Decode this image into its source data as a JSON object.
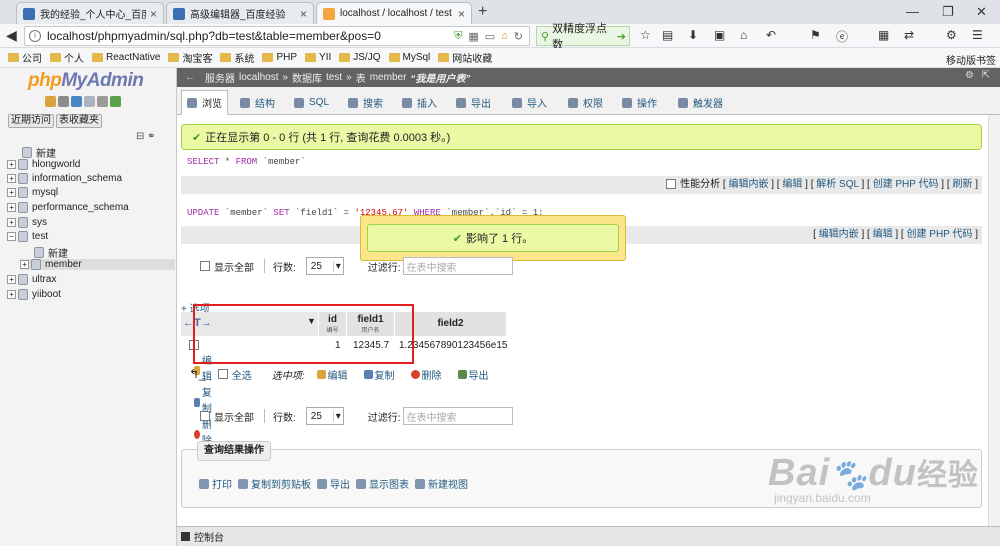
{
  "browser": {
    "tabs": [
      {
        "title": "我的经验_个人中心_百度经",
        "active": false
      },
      {
        "title": "高级编辑器_百度经验",
        "active": false
      },
      {
        "title": "localhost / localhost / test",
        "active": true
      }
    ],
    "new_tab_label": "+",
    "url": "localhost/phpmyadmin/sql.php?db=test&table=member&pos=0",
    "search_placeholder": "双精度浮点数",
    "bookmarks": [
      "公司",
      "个人",
      "ReactNative",
      "淘宝客",
      "系统",
      "PHP",
      "YII",
      "JS/JQ",
      "MySql",
      "网站收藏"
    ],
    "mobile_bookmarks": "移动版书签"
  },
  "sidebar": {
    "logo_php": "php",
    "logo_myadmin": "MyAdmin",
    "recent_label": "近期访问",
    "favorites_label": "表收藏夹",
    "new_label": "新建",
    "databases": [
      {
        "name": "hlongworld",
        "expanded": false
      },
      {
        "name": "information_schema",
        "expanded": false
      },
      {
        "name": "mysql",
        "expanded": false
      },
      {
        "name": "performance_schema",
        "expanded": false
      },
      {
        "name": "sys",
        "expanded": false
      },
      {
        "name": "test",
        "expanded": true
      }
    ],
    "test_children": {
      "new_label": "新建",
      "table": "member"
    },
    "more_databases": [
      "ultrax",
      "yiiboot"
    ]
  },
  "breadcrumb": {
    "server_label": "服务器",
    "server": "localhost",
    "db_label": "数据库",
    "db": "test",
    "table_label": "表",
    "table": "member",
    "table_comment": "“我是用户表”"
  },
  "tabs": [
    "浏览",
    "结构",
    "SQL",
    "搜索",
    "插入",
    "导出",
    "导入",
    "权限",
    "操作",
    "触发器"
  ],
  "messages": {
    "success": "正在显示第 0 - 0 行 (共 1 行, 查询花费 0.0003 秒。)",
    "affected": "影响了 1 行。"
  },
  "sql1": {
    "kw1": "SELECT",
    "rest1": " * ",
    "kw2": "FROM",
    "rest2": " `member`"
  },
  "sql1_options": {
    "profiling": "性能分析",
    "inline_edit": "编辑内嵌",
    "edit": "编辑",
    "explain": "解析 SQL",
    "create_php": "创建 PHP 代码",
    "refresh": "刷新"
  },
  "sql2": {
    "kw1": "UPDATE",
    "rest1": " `member` ",
    "kw2": "SET",
    "rest2": " `field1` = ",
    "val": "'12345.67'",
    "kw3": "WHERE",
    "rest3": " `member`.`id` = 1;"
  },
  "sql2_options": {
    "inline_edit": "编辑内嵌",
    "edit": "编辑",
    "create_php": "创建 PHP 代码"
  },
  "nav": {
    "show_all": "显示全部",
    "rows_label": "行数:",
    "rows_value": "25",
    "filter_label": "过滤行:",
    "filter_placeholder": "在表中搜索"
  },
  "options_link": "+ 选项",
  "table": {
    "columns": [
      {
        "name": "id",
        "comment": "编号"
      },
      {
        "name": "field1",
        "comment": "用户名"
      },
      {
        "name": "field2",
        "comment": ""
      }
    ],
    "row_actions": {
      "edit": "编辑",
      "copy": "复制",
      "delete": "删除"
    },
    "rows": [
      {
        "id": "1",
        "field1": "12345.7",
        "field2": "1.234567890123456e15"
      }
    ]
  },
  "with_selected": {
    "check_all": "全选",
    "label": "选中项:",
    "edit": "编辑",
    "copy": "复制",
    "delete": "删除",
    "export": "导出"
  },
  "query_ops": {
    "title": "查询结果操作",
    "items": [
      "打印",
      "复制到剪贴板",
      "导出",
      "显示图表",
      "新建视图"
    ]
  },
  "console_label": "控制台",
  "watermark": {
    "line1": "Bai",
    "line2": "du",
    "line3": "经验",
    "sub": "jingyan.baidu.com"
  }
}
